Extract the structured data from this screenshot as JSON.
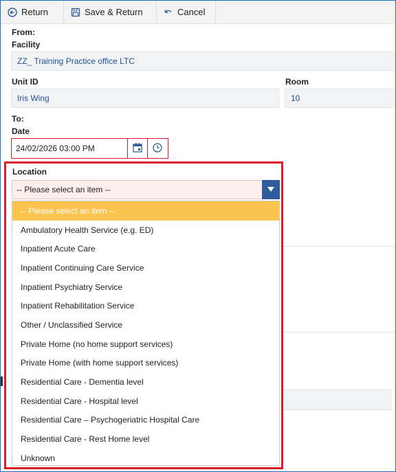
{
  "toolbar": {
    "return_label": "Return",
    "save_return_label": "Save & Return",
    "cancel_label": "Cancel"
  },
  "form": {
    "from_heading": "From:",
    "facility_label": "Facility",
    "facility_value": "ZZ_ Training Practice office LTC",
    "unit_id_label": "Unit ID",
    "unit_id_value": "Iris Wing",
    "room_label": "Room",
    "room_value": "10",
    "to_heading": "To:",
    "date_label": "Date",
    "date_value": "24/02/2026 03:00 PM",
    "location_label": "Location",
    "location_selected": "-- Please select an item --",
    "location_options": [
      "-- Please select an item --",
      "Ambulatory Health Service (e.g. ED)",
      "Inpatient Acute Care",
      "Inpatient Continuing Care Service",
      "Inpatient Psychiatry Service",
      "Inpatient Rehabilitation Service",
      "Other / Unclassified Service",
      "Private Home (no home support services)",
      "Private Home (with home support services)",
      "Residential Care - Dementia level",
      "Residential Care - Hospital level",
      "Residential Care – Psychogeriatric Hospital Care",
      "Residential Care - Rest Home level",
      "Unknown"
    ]
  },
  "icons": {
    "return": "return-icon",
    "save": "save-icon",
    "cancel": "undo-icon",
    "calendar": "calendar-icon",
    "clock": "clock-icon",
    "dropdown": "chevron-down-icon"
  },
  "colors": {
    "accent_blue": "#2f5d9c",
    "value_blue": "#1f4f96",
    "error_red": "#d9202a",
    "highlight": "#fcc44c"
  }
}
